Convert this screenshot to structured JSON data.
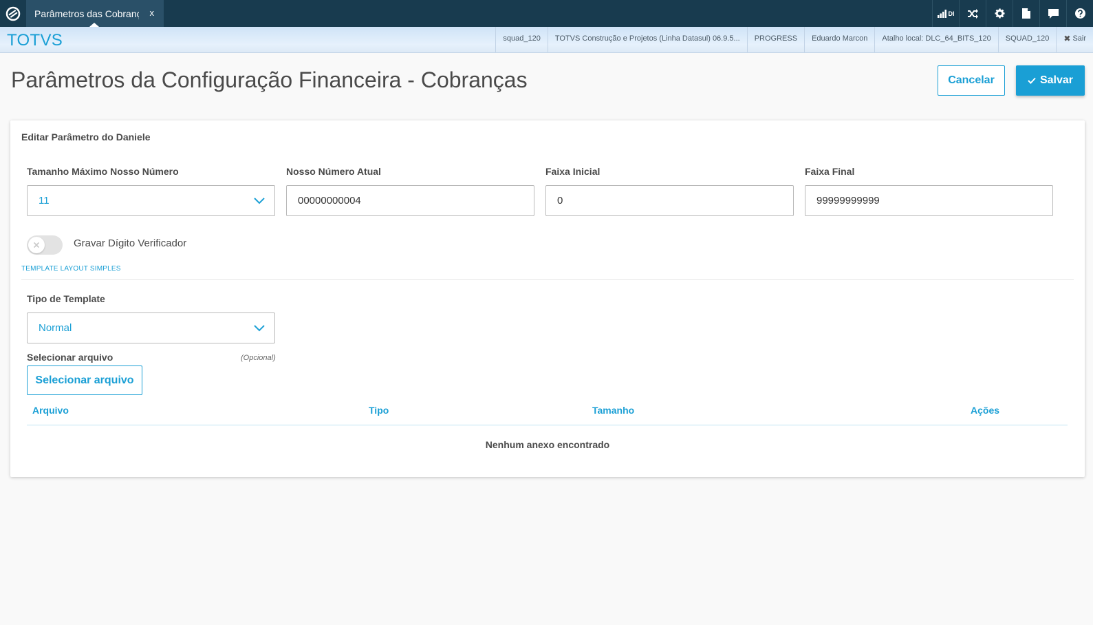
{
  "tab": {
    "title": "Parâmetros das Cobranças",
    "close_glyph": "x"
  },
  "toolbar": {
    "signal_text": "DI"
  },
  "header": {
    "brand": "TOTVS",
    "info_items": [
      "squad_120",
      "TOTVS Construção e Projetos (Linha Datasul) 06.9.5...",
      "PROGRESS",
      "Eduardo Marcon",
      "Atalho local: DLC_64_BITS_120",
      "SQUAD_120"
    ],
    "exit_label": "Sair"
  },
  "page": {
    "title": "Parâmetros da Configuração Financeira - Cobranças",
    "cancel_label": "Cancelar",
    "save_label": "Salvar"
  },
  "form": {
    "card_title": "Editar Parâmetro do Daniele",
    "max_size_label": "Tamanho Máximo Nosso Número",
    "max_size_value": "11",
    "current_number_label": "Nosso Número Atual",
    "current_number_value": "00000000004",
    "range_start_label": "Faixa Inicial",
    "range_start_value": "0",
    "range_end_label": "Faixa Final",
    "range_end_value": "99999999999",
    "check_digit_label": "Gravar Dígito Verificador",
    "check_digit_on": false,
    "section_label": "TEMPLATE LAYOUT SIMPLES",
    "template_type_label": "Tipo de Template",
    "template_type_value": "Normal",
    "file_label": "Selecionar arquivo",
    "file_optional": "(Opcional)",
    "file_button": "Selecionar arquivo"
  },
  "attachments": {
    "columns": [
      "Arquivo",
      "Tipo",
      "Tamanho",
      "Ações"
    ],
    "empty_message": "Nenhum anexo encontrado"
  },
  "colors": {
    "topbar": "#183b4f",
    "accent": "#1a9fd5"
  }
}
